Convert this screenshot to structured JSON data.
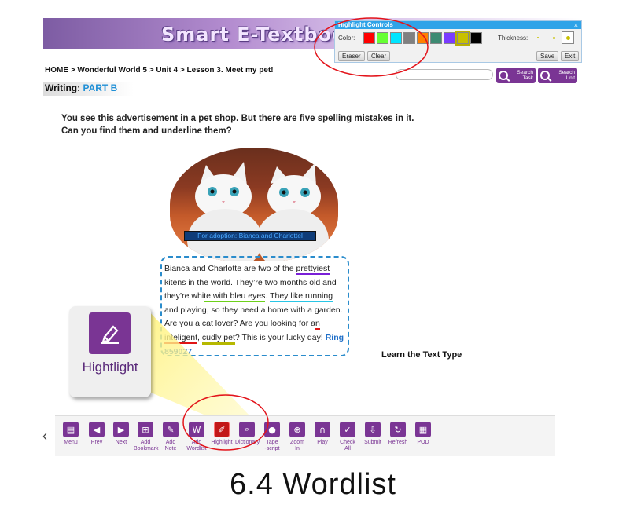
{
  "header": {
    "logo_text": "Smart E-Textbook"
  },
  "highlight_controls": {
    "title": "Highlight Controls",
    "close": "×",
    "color_label": "Color:",
    "colors": [
      "#ff0000",
      "#66ff33",
      "#00e5ff",
      "#808080",
      "#ff8000",
      "#3d8a72",
      "#7a3cff",
      "#c8c000",
      "#000000"
    ],
    "selected_color": "#c8c000",
    "thickness_label": "Thickness:",
    "eraser_label": "Eraser",
    "clear_label": "Clear",
    "save_label": "Save",
    "exit_label": "Exit"
  },
  "breadcrumb": {
    "home": "HOME",
    "sep": ">",
    "book": "Wonderful World 5",
    "unit": "Unit 4",
    "lesson": "Lesson 3. Meet my pet!"
  },
  "search": {
    "task_label_1": "Search",
    "task_label_2": "Task",
    "unit_label_1": "Search",
    "unit_label_2": "Unit"
  },
  "section": {
    "title": "Writing:",
    "part": "PART B"
  },
  "instructions": {
    "line1": "You see this advertisement in a pet shop. But there are five spelling mistakes in it.",
    "line2": "Can you find them and underline them?"
  },
  "picture_caption": "For adoption: Bianca and Charlottel",
  "advert": {
    "t1": "Bianca and Charlotte are two of the ",
    "w1": "prettyiest",
    "t2": " kitens in the world. They’re two months old and they’re whi",
    "w2": "te with bleu eyes",
    "t3": ". ",
    "w3": "They like running",
    "t4": " and playing, so they need a home with a garden. Are you a cat lover? Are you looking for a",
    "w4": "n inteligent",
    "t5": ", ",
    "w5": "cudly pet",
    "t6": "? This is your lucky day! ",
    "ring": "Ring 859027",
    "t7": "."
  },
  "learn_text_type": "Learn the Text Type",
  "highlight_tooltip": {
    "label": "Hightlight",
    "icon": "highlighter-icon"
  },
  "toolbar": {
    "items": [
      {
        "label": "Menu",
        "icon": "menu-icon"
      },
      {
        "label": "Prev",
        "icon": "arrow-left-icon"
      },
      {
        "label": "Next",
        "icon": "arrow-right-icon"
      },
      {
        "label": "Add Bookmark",
        "icon": "bookmark-icon"
      },
      {
        "label": "Add Note",
        "icon": "note-icon"
      },
      {
        "label": "Add Wordlist",
        "icon": "wordlist-icon"
      },
      {
        "label": "Highlight",
        "icon": "highlighter-icon"
      },
      {
        "label": "Dictionary",
        "icon": "dictionary-icon"
      },
      {
        "label": "Tape -script",
        "icon": "speech-bubble-icon"
      },
      {
        "label": "Zoom In",
        "icon": "zoom-in-icon"
      },
      {
        "label": "Play",
        "icon": "headphones-icon"
      },
      {
        "label": "Check All",
        "icon": "check-icon"
      },
      {
        "label": "Submit",
        "icon": "download-icon"
      },
      {
        "label": "Refresh",
        "icon": "refresh-icon"
      },
      {
        "label": "POD",
        "icon": "print-icon"
      }
    ],
    "active": "Highlight"
  },
  "slide_caption": "6.4 Wordlist"
}
